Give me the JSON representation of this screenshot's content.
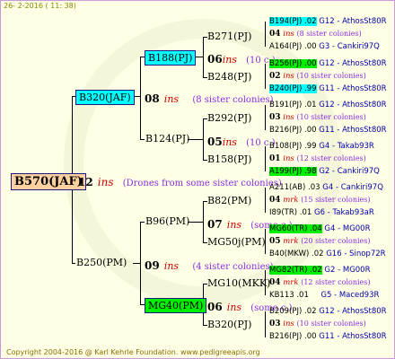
{
  "header": {
    "date": "26-  2-2016 ( 11: 38)"
  },
  "footer": {
    "copyright": "Copyright 2004-2016 @ Karl Kehrle Foundation.   www.pedigreeapis.org"
  },
  "tree": {
    "root": {
      "label": "B570(JAF)",
      "num": "12",
      "ins": "ins",
      "desc": "(Drones from some sister colonies)"
    },
    "sire": {
      "label": "B320(JAF)",
      "num": "08",
      "ins": "ins",
      "desc": "(8 sister colonies)"
    },
    "dam": {
      "label": "B250(PM)",
      "num": "09",
      "ins": "ins",
      "desc": "(4 sister colonies)"
    },
    "s1": {
      "label": "B188(PJ)",
      "num": "06",
      "ins": "ins",
      "desc": "(10 c.)"
    },
    "s2": {
      "label": "B124(PJ)",
      "num": "05",
      "ins": "ins",
      "desc": "(10 c.)"
    },
    "d1": {
      "label": "B96(PM)",
      "num": "07",
      "ins": "ins",
      "desc": "(some c.)"
    },
    "d2": {
      "label": "MG40(PM)",
      "num": "06",
      "ins": "ins",
      "desc": "(some c.)"
    },
    "g1": {
      "label": "B271(PJ)"
    },
    "g2": {
      "label": "B248(PJ)"
    },
    "g3": {
      "label": "B292(PJ)"
    },
    "g4": {
      "label": "B158(PJ)"
    },
    "g5": {
      "label": "B82(PM)"
    },
    "g6": {
      "label": "MG50j(PM)"
    },
    "g7": {
      "label": "MG10(MKK)"
    },
    "g8": {
      "label": "B320(PJ)"
    }
  },
  "right": [
    {
      "id": "r1",
      "code": "B194(PJ) .02",
      "src": "G12 - AthosSt80R"
    },
    {
      "id": "r1n",
      "num": "04",
      "ins": "ins",
      "desc": "(8 sister colonies)"
    },
    {
      "id": "r2",
      "code": "A164(PJ) .00",
      "src": "G3 - Cankiri97Q"
    },
    {
      "id": "r3",
      "code": "B256(PJ) .00",
      "src": "G12 - AthosSt80R"
    },
    {
      "id": "r3n",
      "num": "02",
      "ins": "ins",
      "desc": "(10 sister colonies)"
    },
    {
      "id": "r4",
      "code": "B240(PJ) .99",
      "src": "G11 - AthosSt80R"
    },
    {
      "id": "r5",
      "code": "B191(PJ) .01",
      "src": "G12 - AthosSt80R"
    },
    {
      "id": "r5n",
      "num": "03",
      "ins": "ins",
      "desc": "(10 sister colonies)"
    },
    {
      "id": "r6",
      "code": "B216(PJ) .00",
      "src": "G11 - AthosSt80R"
    },
    {
      "id": "r7",
      "code": "B108(PJ) .99",
      "src": "G4 - Takab93R"
    },
    {
      "id": "r7n",
      "num": "01",
      "ins": "ins",
      "desc": "(12 sister colonies)"
    },
    {
      "id": "r8",
      "code": "A199(PJ) .98",
      "src": "G2 - Cankiri97Q"
    },
    {
      "id": "r9",
      "code": "A211(AB) .03",
      "src": "G4 - Cankiri97Q"
    },
    {
      "id": "r9n",
      "num": "04",
      "ins": "mrk",
      "desc": "(15 sister colonies)"
    },
    {
      "id": "r10",
      "code": "I89(TR) .01",
      "src": "G6 - Takab93aR"
    },
    {
      "id": "r11",
      "code": "MG60(TR) .04",
      "src": "G4 - MG00R"
    },
    {
      "id": "r11n",
      "num": "05",
      "ins": "mrk",
      "desc": "(20 sister colonies)"
    },
    {
      "id": "r12",
      "code": "B40(MKW) .02",
      "src": "G16 - Sinop72R"
    },
    {
      "id": "r13",
      "code": "MG82(TR) .02",
      "src": "G2 - MG00R"
    },
    {
      "id": "r13n",
      "num": "04",
      "ins": "mrk",
      "desc": "(12 sister colonies)"
    },
    {
      "id": "r14",
      "code": "KB113 .01",
      "src": "G5 - Maced93R"
    },
    {
      "id": "r15",
      "code": "B209(PJ) .02",
      "src": "G12 - AthosSt80R"
    },
    {
      "id": "r15n",
      "num": "03",
      "ins": "ins",
      "desc": "(10 sister colonies)"
    },
    {
      "id": "r16",
      "code": "B216(PJ) .00",
      "src": "G11 - AthosSt80R"
    }
  ],
  "colors": {
    "highlight_cyan": "#00ffff",
    "highlight_green": "#00ee00",
    "ins_red": "#cc0000",
    "desc_purple": "#8a2be2"
  }
}
